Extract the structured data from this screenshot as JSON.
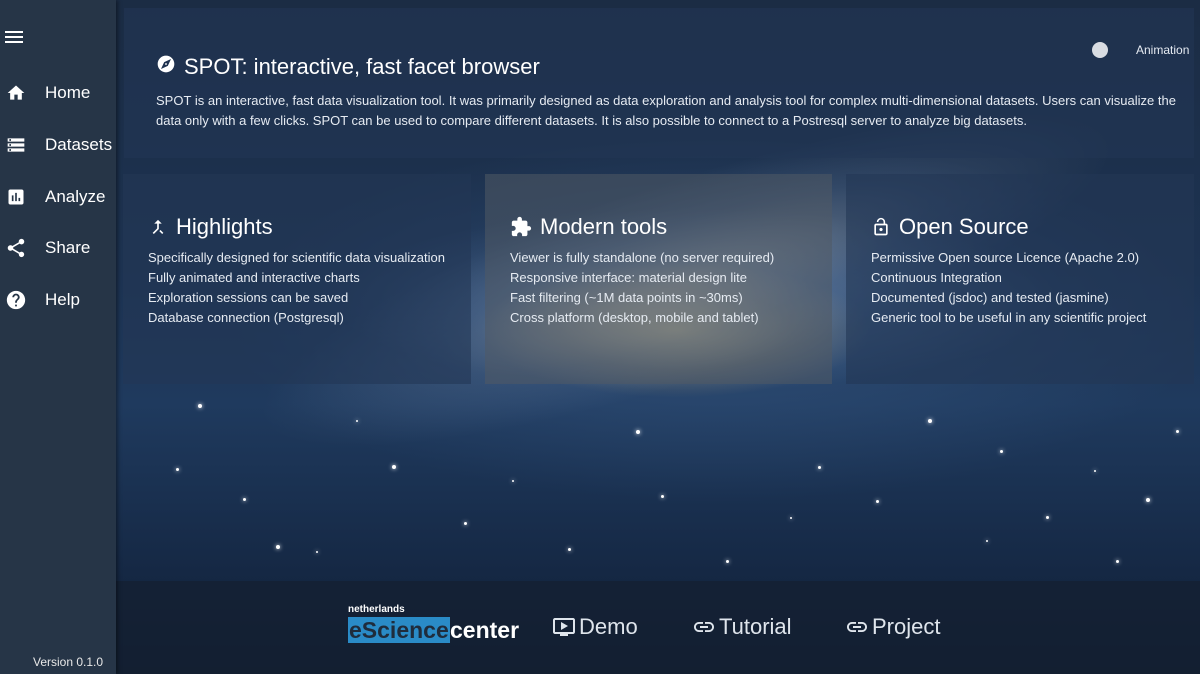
{
  "sidebar": {
    "items": [
      {
        "label": "Home",
        "icon": "home-icon"
      },
      {
        "label": "Datasets",
        "icon": "storage-icon"
      },
      {
        "label": "Analyze",
        "icon": "chart-icon"
      },
      {
        "label": "Share",
        "icon": "share-icon"
      },
      {
        "label": "Help",
        "icon": "help-icon"
      }
    ],
    "version": "Version 0.1.0"
  },
  "header": {
    "title": "SPOT: interactive, fast facet browser",
    "description": "SPOT is an interactive, fast data visualization tool. It was primarily designed as data exploration and analysis tool for complex multi-dimensional datasets. Users can visualize the data only with a few clicks. SPOT can be used to compare different datasets. It is also possible to connect to a Postresql server to analyze big datasets.",
    "animation_label": "Animation"
  },
  "cards": [
    {
      "title": "Highlights",
      "icon": "merge-icon",
      "items": [
        "Specifically designed for scientific data visualization",
        "Fully animated and interactive charts",
        "Exploration sessions can be saved",
        "Database connection (Postgresql)"
      ]
    },
    {
      "title": "Modern tools",
      "icon": "puzzle-icon",
      "items": [
        "Viewer is fully standalone (no server required)",
        "Responsive interface: material design lite",
        "Fast filtering (~1M data points in ~30ms)",
        "Cross platform (desktop, mobile and tablet)"
      ]
    },
    {
      "title": "Open Source",
      "icon": "lock-open-icon",
      "items": [
        "Permissive Open source Licence (Apache 2.0)",
        "Continuous Integration",
        "Documented (jsdoc) and tested (jasmine)",
        "Generic tool to be useful in any scientific project"
      ]
    }
  ],
  "footer": {
    "logo_small": "netherlands",
    "logo_science": "eScience",
    "logo_center": "center",
    "links": [
      {
        "label": "Demo",
        "icon": "demo-icon"
      },
      {
        "label": "Tutorial",
        "icon": "link-icon"
      },
      {
        "label": "Project",
        "icon": "link-icon"
      }
    ]
  },
  "colors": {
    "sidebar": "#263547",
    "logo_accent": "#2a8bc7"
  }
}
